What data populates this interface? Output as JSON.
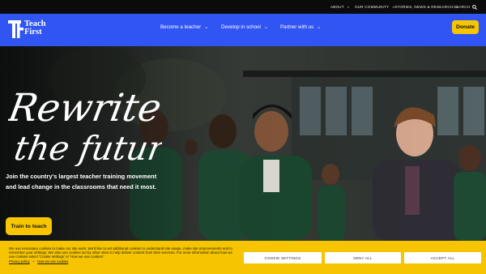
{
  "utility_nav": [
    {
      "label": "ABOUT",
      "icon": "chevron-down-icon"
    },
    {
      "label": "OUR COMMUNITY",
      "icon": "chevron-down-icon"
    },
    {
      "label": "STORIES, NEWS & RESEARCH",
      "icon": "chevron-down-icon"
    },
    {
      "label": "SEARCH",
      "icon": "search-icon"
    }
  ],
  "brand": {
    "line1": "Teach",
    "line2": "First"
  },
  "main_nav": [
    {
      "label": "Become a teacher",
      "icon": "chevron-down-icon"
    },
    {
      "label": "Develop in school",
      "icon": "chevron-down-icon"
    },
    {
      "label": "Partner with us",
      "icon": "chevron-down-icon"
    }
  ],
  "donate_label": "Donate",
  "hero": {
    "headline_line1": "Rewrite",
    "headline_line2": "the future",
    "subheading": "Join the country's largest teacher training movement and lead change in the classrooms that need it most.",
    "cta_label": "Train to teach"
  },
  "cookie": {
    "message": "We use necessary cookies to make our site work. We'd like to set additional cookies to understand site usage, make site improvements and to remember your settings. We also use cookies set by other sites to help deliver content from their services. For more information about how we use cookies select 'Cookie settings' or 'How we use cookies'.",
    "links": [
      "Privacy policy",
      "How we use cookies"
    ],
    "separator": "•",
    "buttons": [
      "COOKIE SETTINGS",
      "DENY ALL",
      "ACCEPT ALL"
    ]
  },
  "colors": {
    "nav_blue": "#3155f2",
    "accent_yellow": "#f7c600",
    "top_bar": "#0b0b0b"
  }
}
